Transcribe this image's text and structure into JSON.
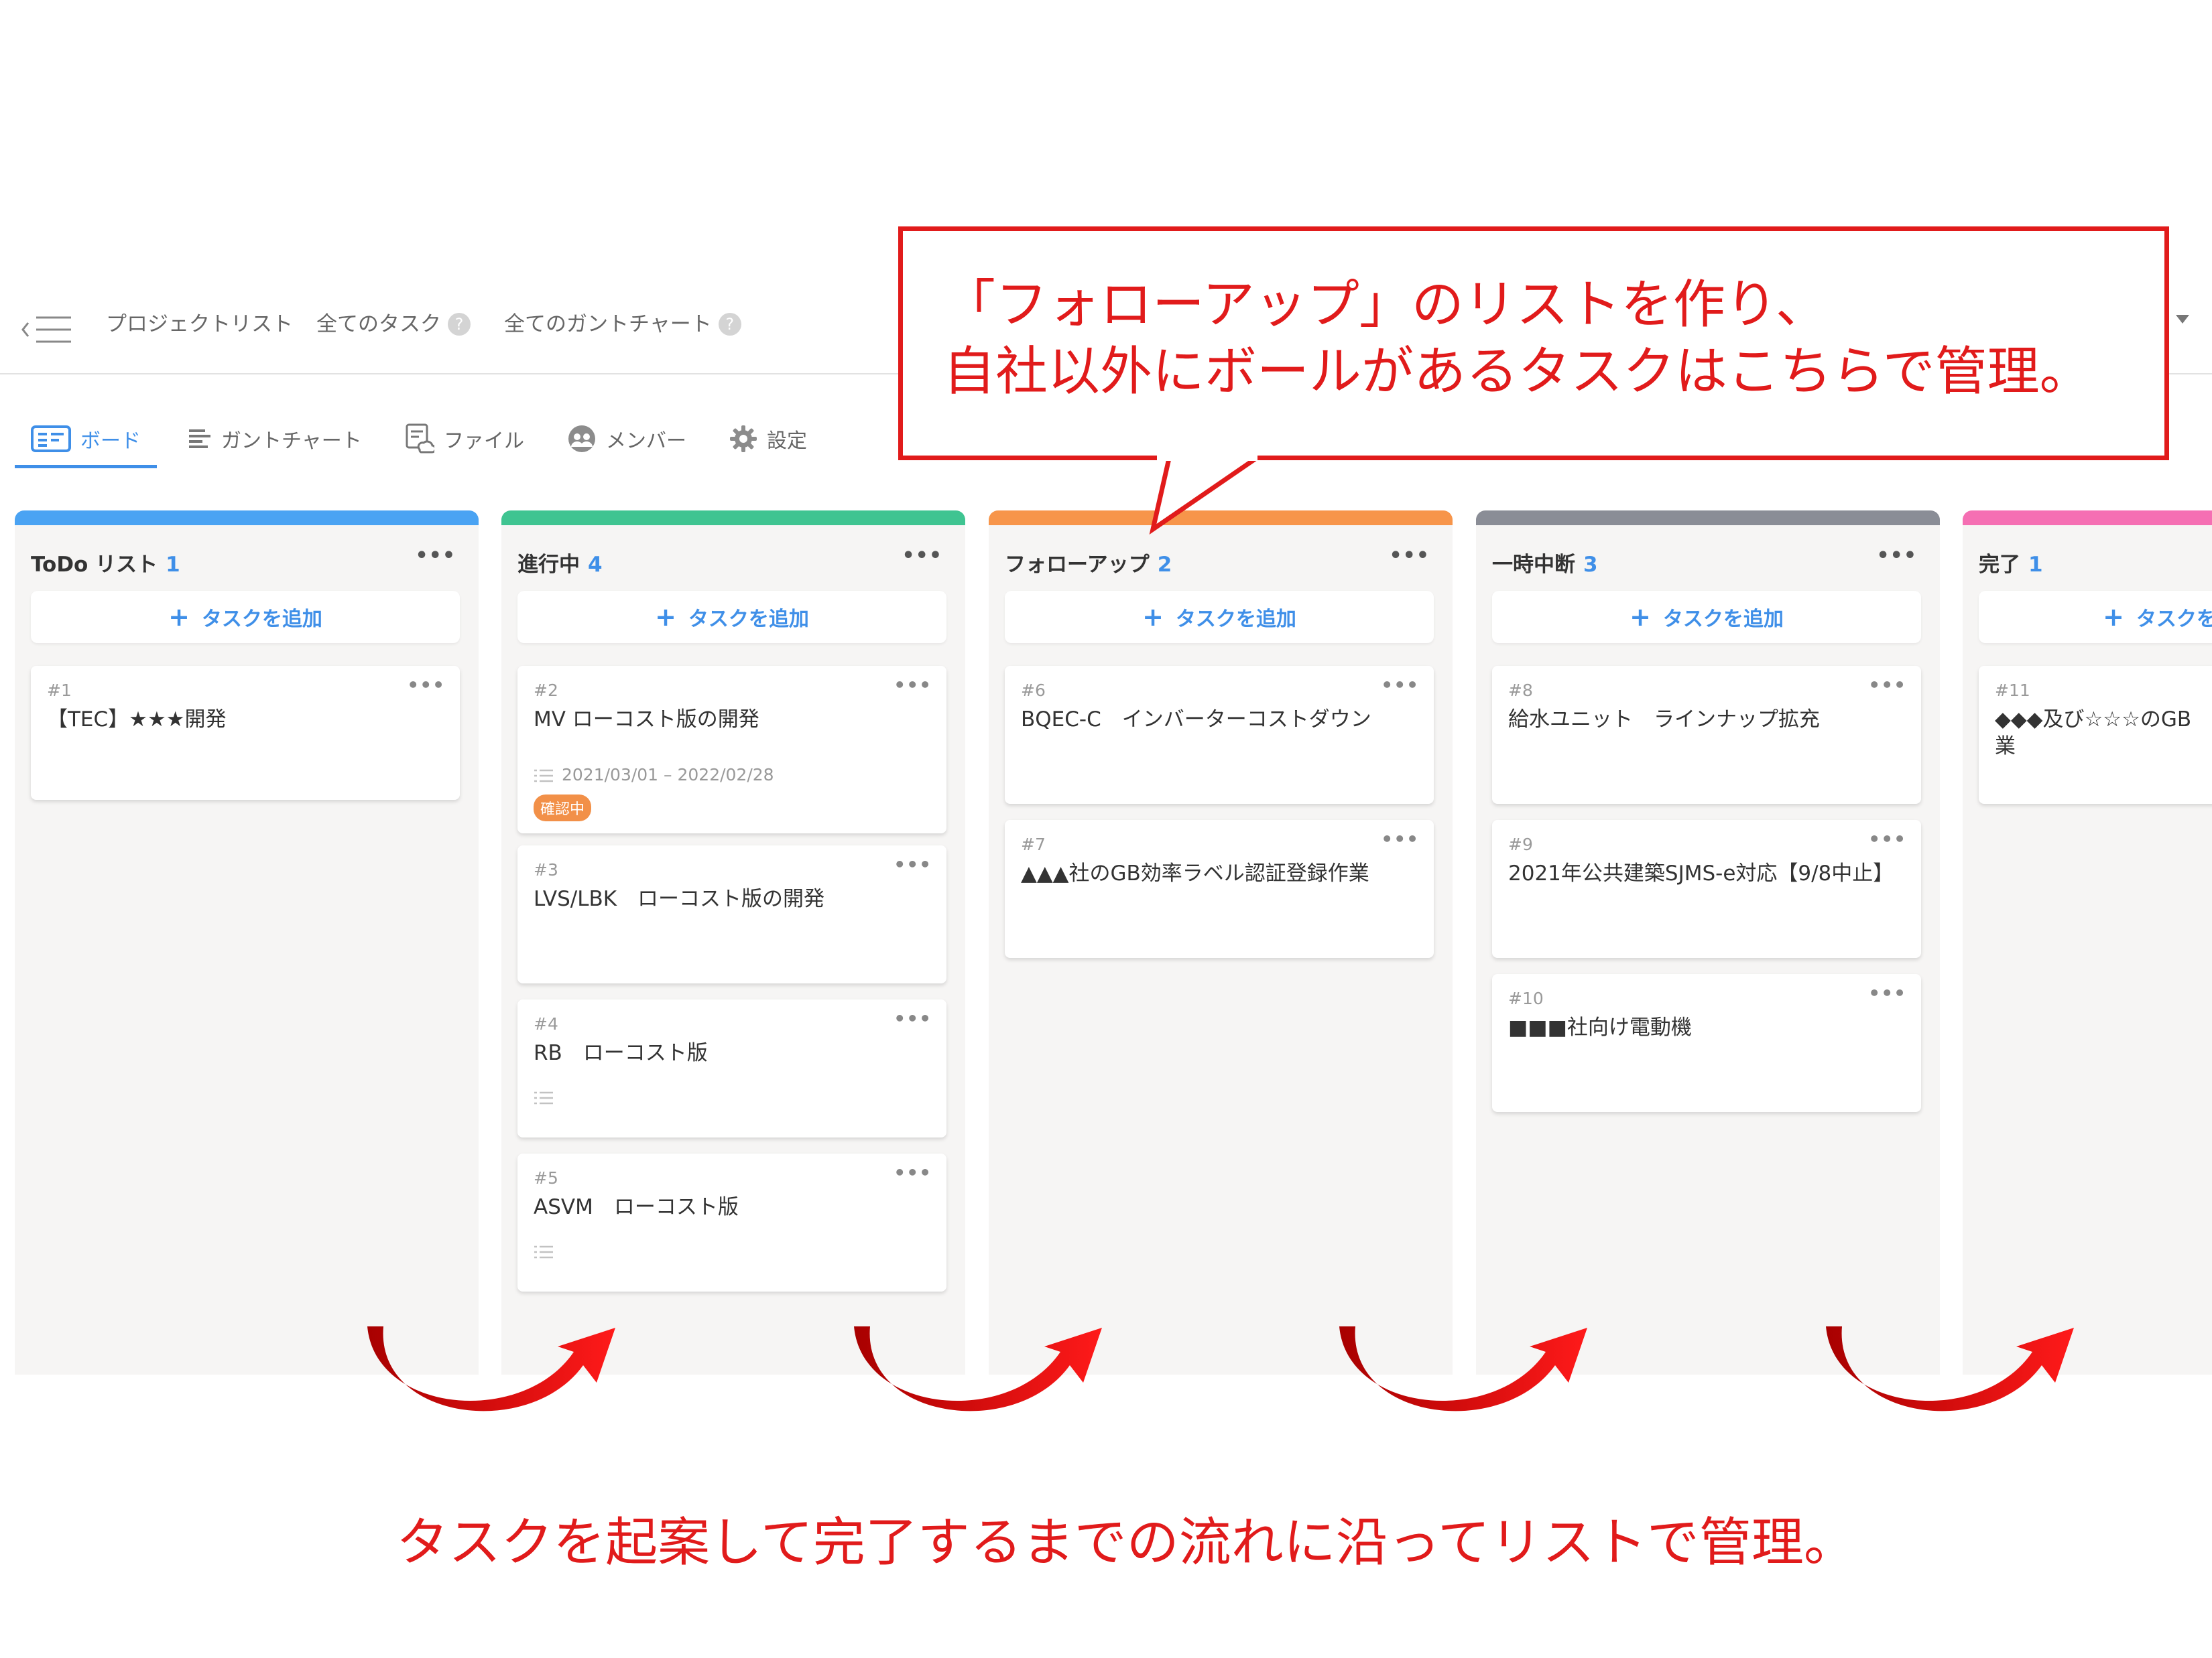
{
  "header": {
    "nav": [
      "プロジェクトリスト",
      "全てのタスク",
      "全てのガントチャート"
    ],
    "help_glyph": "?"
  },
  "tabs": [
    {
      "label": "ボード",
      "active": true
    },
    {
      "label": "ガントチャート"
    },
    {
      "label": "ファイル"
    },
    {
      "label": "メンバー"
    },
    {
      "label": "設定"
    }
  ],
  "board": {
    "add_label": "タスクを追加",
    "plus": "+",
    "menu_glyph": "•••",
    "columns": [
      {
        "title": "ToDo リスト",
        "count": "1",
        "color": "#4aa3f3",
        "cards": [
          {
            "id": "#1",
            "title": "【TEC】★★★開発"
          }
        ]
      },
      {
        "title": "進行中",
        "count": "4",
        "color": "#3fc491",
        "cards": [
          {
            "id": "#2",
            "title": "MV ローコスト版の開発",
            "date": "2021/03/01 – 2022/02/28",
            "badge": "確認中"
          },
          {
            "id": "#3",
            "title": "LVS/LBK　ローコスト版の開発"
          },
          {
            "id": "#4",
            "title": "RB　ローコスト版"
          },
          {
            "id": "#5",
            "title": "ASVM　ローコスト版"
          }
        ]
      },
      {
        "title": "フォローアップ",
        "count": "2",
        "color": "#f7954a",
        "cards": [
          {
            "id": "#6",
            "title": "BQEC-C　インバーターコストダウン"
          },
          {
            "id": "#7",
            "title": "▲▲▲社のGB効率ラベル認証登録作業"
          }
        ]
      },
      {
        "title": "一時中断",
        "count": "3",
        "color": "#8a8d96",
        "cards": [
          {
            "id": "#8",
            "title": "給水ユニット　ラインナップ拡充"
          },
          {
            "id": "#9",
            "title": "2021年公共建築SJMS-e対応【9/8中止】"
          },
          {
            "id": "#10",
            "title": "■■■社向け電動機"
          }
        ]
      },
      {
        "title": "完了",
        "count": "1",
        "color": "#f56fb3",
        "cards": [
          {
            "id": "#11",
            "title": "◆◆◆及び☆☆☆のGB",
            "title2": "業"
          }
        ]
      }
    ]
  },
  "callout": {
    "line1": "「フォローアップ」のリストを作り、",
    "line2": "自社以外にボールがあるタスクはこちらで管理。"
  },
  "bottom_message": "タスクを起案して完了するまでの流れに沿ってリストで管理。",
  "colors": {
    "accent": "#3f8fe8",
    "annotation": "#e11b1b",
    "badge": "#f29048"
  }
}
